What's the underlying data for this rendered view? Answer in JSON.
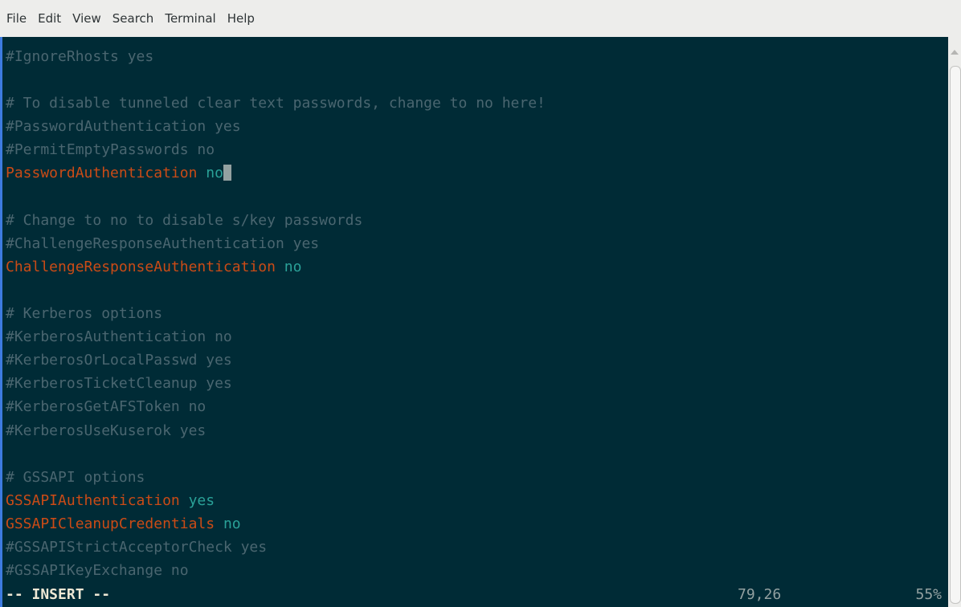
{
  "menu": {
    "file": "File",
    "edit": "Edit",
    "view": "View",
    "search": "Search",
    "terminal": "Terminal",
    "help": "Help"
  },
  "editor": {
    "lines": [
      {
        "kind": "comment",
        "text": "#IgnoreRhosts yes"
      },
      {
        "kind": "blank",
        "text": ""
      },
      {
        "kind": "comment",
        "text": "# To disable tunneled clear text passwords, change to no here!"
      },
      {
        "kind": "comment",
        "text": "#PasswordAuthentication yes"
      },
      {
        "kind": "comment",
        "text": "#PermitEmptyPasswords no"
      },
      {
        "kind": "setting",
        "key": "PasswordAuthentication",
        "value": "no",
        "cursor": true
      },
      {
        "kind": "blank",
        "text": ""
      },
      {
        "kind": "comment",
        "text": "# Change to no to disable s/key passwords"
      },
      {
        "kind": "comment",
        "text": "#ChallengeResponseAuthentication yes"
      },
      {
        "kind": "setting",
        "key": "ChallengeResponseAuthentication",
        "value": "no"
      },
      {
        "kind": "blank",
        "text": ""
      },
      {
        "kind": "comment",
        "text": "# Kerberos options"
      },
      {
        "kind": "comment",
        "text": "#KerberosAuthentication no"
      },
      {
        "kind": "comment",
        "text": "#KerberosOrLocalPasswd yes"
      },
      {
        "kind": "comment",
        "text": "#KerberosTicketCleanup yes"
      },
      {
        "kind": "comment",
        "text": "#KerberosGetAFSToken no"
      },
      {
        "kind": "comment",
        "text": "#KerberosUseKuserok yes"
      },
      {
        "kind": "blank",
        "text": ""
      },
      {
        "kind": "comment",
        "text": "# GSSAPI options"
      },
      {
        "kind": "setting",
        "key": "GSSAPIAuthentication",
        "value": "yes"
      },
      {
        "kind": "setting",
        "key": "GSSAPICleanupCredentials",
        "value": "no"
      },
      {
        "kind": "comment",
        "text": "#GSSAPIStrictAcceptorCheck yes"
      },
      {
        "kind": "comment",
        "text": "#GSSAPIKeyExchange no"
      }
    ]
  },
  "status": {
    "mode": "-- INSERT --",
    "position": "79,26",
    "percent": "55%"
  },
  "colors": {
    "background": "#002b36",
    "comment": "#4a6670",
    "key": "#cb4b16",
    "value": "#2aa198"
  }
}
